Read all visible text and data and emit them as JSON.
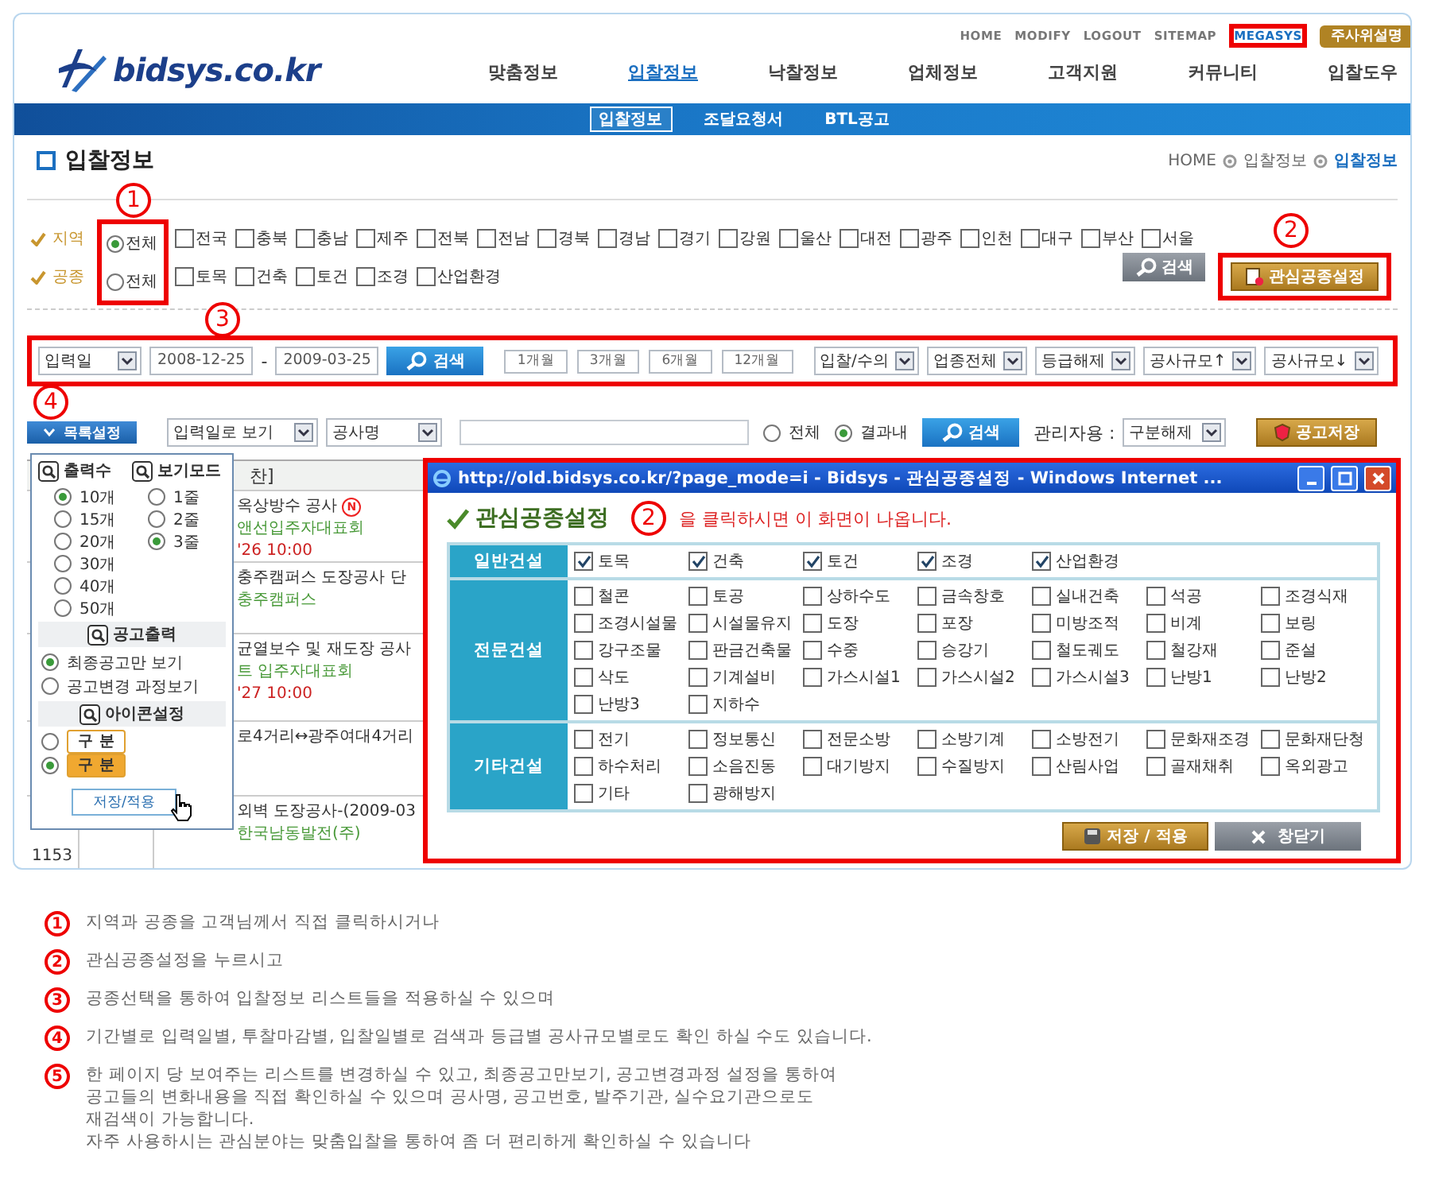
{
  "header": {
    "logo": "bidsys.co.kr",
    "top_links": [
      {
        "label": "HOME",
        "highlighted": false
      },
      {
        "label": "MODIFY",
        "highlighted": false
      },
      {
        "label": "LOGOUT",
        "highlighted": false
      },
      {
        "label": "SITEMAP",
        "highlighted": false
      },
      {
        "label": "MEGASYS",
        "highlighted": true
      }
    ],
    "top_button": "주사위설명",
    "nav": [
      {
        "label": "맞춤정보",
        "selected": false
      },
      {
        "label": "입찰정보",
        "selected": true
      },
      {
        "label": "낙찰정보",
        "selected": false
      },
      {
        "label": "업체정보",
        "selected": false
      },
      {
        "label": "고객지원",
        "selected": false
      },
      {
        "label": "커뮤니티",
        "selected": false
      },
      {
        "label": "입찰도우",
        "selected": false
      }
    ],
    "subnav": [
      {
        "label": "입찰정보",
        "selected": true
      },
      {
        "label": "조달요청서",
        "selected": false
      },
      {
        "label": "BTL공고",
        "selected": false
      }
    ]
  },
  "page_title": "입찰정보",
  "breadcrumb": [
    "HOME",
    "입찰정보",
    "입찰정보"
  ],
  "filters": [
    {
      "label": "지역",
      "options": [
        {
          "label": "전체",
          "kind": "radio",
          "checked": true
        },
        {
          "label": "전국",
          "kind": "checkbox",
          "checked": false
        },
        {
          "label": "충북",
          "kind": "checkbox",
          "checked": false
        },
        {
          "label": "충남",
          "kind": "checkbox",
          "checked": false
        },
        {
          "label": "제주",
          "kind": "checkbox",
          "checked": false
        },
        {
          "label": "전북",
          "kind": "checkbox",
          "checked": false
        },
        {
          "label": "전남",
          "kind": "checkbox",
          "checked": false
        },
        {
          "label": "경북",
          "kind": "checkbox",
          "checked": false
        },
        {
          "label": "경남",
          "kind": "checkbox",
          "checked": false
        },
        {
          "label": "경기",
          "kind": "checkbox",
          "checked": false
        },
        {
          "label": "강원",
          "kind": "checkbox",
          "checked": false
        },
        {
          "label": "울산",
          "kind": "checkbox",
          "checked": false
        },
        {
          "label": "대전",
          "kind": "checkbox",
          "checked": false
        },
        {
          "label": "광주",
          "kind": "checkbox",
          "checked": false
        },
        {
          "label": "인천",
          "kind": "checkbox",
          "checked": false
        },
        {
          "label": "대구",
          "kind": "checkbox",
          "checked": false
        },
        {
          "label": "부산",
          "kind": "checkbox",
          "checked": false
        },
        {
          "label": "서울",
          "kind": "checkbox",
          "checked": false
        }
      ]
    },
    {
      "label": "공종",
      "options": [
        {
          "label": "전체",
          "kind": "radio",
          "checked": false
        },
        {
          "label": "토목",
          "kind": "checkbox",
          "checked": false
        },
        {
          "label": "건축",
          "kind": "checkbox",
          "checked": false
        },
        {
          "label": "토건",
          "kind": "checkbox",
          "checked": false
        },
        {
          "label": "조경",
          "kind": "checkbox",
          "checked": false
        },
        {
          "label": "산업환경",
          "kind": "checkbox",
          "checked": false
        }
      ]
    }
  ],
  "filter_buttons": {
    "search": "검색",
    "interest": "관심공종설정"
  },
  "date_bar": {
    "date_type": "입력일",
    "from": "2008-12-25",
    "separator": "-",
    "to": "2009-03-25",
    "search": "검색",
    "periods": [
      "1개월",
      "3개월",
      "6개월",
      "12개월"
    ],
    "selects": [
      "입찰/수의",
      "업종전체",
      "등급해제",
      "공사규모↑",
      "공사규모↓"
    ]
  },
  "list_bar": {
    "settings_button": "목록설정",
    "view_select": "입력일로 보기",
    "field_select": "공사명",
    "scope": [
      {
        "label": "전체",
        "selected": false
      },
      {
        "label": "결과내",
        "selected": true
      }
    ],
    "search": "검색",
    "admin_label": "관리자용 :",
    "admin_select": "구분해제",
    "save": "공고저장"
  },
  "settings_panel": {
    "count_title": "출력수",
    "counts": [
      {
        "label": "10개",
        "selected": true
      },
      {
        "label": "15개",
        "selected": false
      },
      {
        "label": "20개",
        "selected": false
      },
      {
        "label": "30개",
        "selected": false
      },
      {
        "label": "40개",
        "selected": false
      },
      {
        "label": "50개",
        "selected": false
      }
    ],
    "mode_title": "보기모드",
    "modes": [
      {
        "label": "1줄",
        "selected": false
      },
      {
        "label": "2줄",
        "selected": false
      },
      {
        "label": "3줄",
        "selected": true
      }
    ],
    "notice_title": "공고출력",
    "notice_options": [
      {
        "label": "최종공고만 보기",
        "selected": true
      },
      {
        "label": "공고변경 과정보기",
        "selected": false
      }
    ],
    "icon_title": "아이콘설정",
    "icon_options": [
      {
        "label": "구 분",
        "kind": "outline",
        "selected": false
      },
      {
        "label": "구 분",
        "kind": "filled",
        "selected": true
      }
    ],
    "apply": "저장/적용"
  },
  "list": {
    "header": "찬]",
    "rows": [
      {
        "number": "",
        "lines": [
          {
            "kind": "title",
            "text": "옥상방수 공사",
            "badge": "N"
          },
          {
            "kind": "org",
            "text": "앤선입주자대표회"
          },
          {
            "kind": "date",
            "text": "'26 10:00"
          }
        ]
      },
      {
        "number": "",
        "lines": [
          {
            "kind": "title",
            "text": "충주캠퍼스 도장공사 단"
          },
          {
            "kind": "org",
            "text": "충주캠퍼스"
          }
        ]
      },
      {
        "number": "",
        "lines": [
          {
            "kind": "title",
            "text": "균열보수 및 재도장 공사"
          },
          {
            "kind": "org",
            "text": "트 입주자대표회"
          },
          {
            "kind": "date",
            "text": "'27 10:00"
          }
        ]
      },
      {
        "number": "",
        "lines": [
          {
            "kind": "title",
            "text": "로4거리↔광주여대4거리"
          }
        ]
      },
      {
        "number": "1153",
        "lines": [
          {
            "kind": "title",
            "text": "외벽 도장공사-(2009-03"
          },
          {
            "kind": "org",
            "text": "한국남동발전(주)"
          }
        ]
      }
    ]
  },
  "popup": {
    "title": "http://old.bidsys.co.kr/?page_mode=i - Bidsys - 관심공종설정 - Windows Internet ...",
    "heading": "관심공종설정",
    "heading_marker": "2",
    "heading_note": "을 클릭하시면 이 화면이 나옵니다.",
    "groups": [
      {
        "name": "일반건설",
        "items": [
          {
            "label": "토목",
            "checked": true
          },
          {
            "label": "건축",
            "checked": true
          },
          {
            "label": "토건",
            "checked": true
          },
          {
            "label": "조경",
            "checked": true
          },
          {
            "label": "산업환경",
            "checked": true
          }
        ]
      },
      {
        "name": "전문건설",
        "items": [
          {
            "label": "철콘",
            "checked": false
          },
          {
            "label": "토공",
            "checked": false
          },
          {
            "label": "상하수도",
            "checked": false
          },
          {
            "label": "금속창호",
            "checked": false
          },
          {
            "label": "실내건축",
            "checked": false
          },
          {
            "label": "석공",
            "checked": false
          },
          {
            "label": "조경식재",
            "checked": false
          },
          {
            "label": "조경시설물",
            "checked": false
          },
          {
            "label": "시설물유지",
            "checked": false
          },
          {
            "label": "도장",
            "checked": false
          },
          {
            "label": "포장",
            "checked": false
          },
          {
            "label": "미방조적",
            "checked": false
          },
          {
            "label": "비계",
            "checked": false
          },
          {
            "label": "보링",
            "checked": false
          },
          {
            "label": "강구조물",
            "checked": false
          },
          {
            "label": "판금건축물",
            "checked": false
          },
          {
            "label": "수중",
            "checked": false
          },
          {
            "label": "승강기",
            "checked": false
          },
          {
            "label": "철도궤도",
            "checked": false
          },
          {
            "label": "철강재",
            "checked": false
          },
          {
            "label": "준설",
            "checked": false
          },
          {
            "label": "삭도",
            "checked": false
          },
          {
            "label": "기계설비",
            "checked": false
          },
          {
            "label": "가스시설1",
            "checked": false
          },
          {
            "label": "가스시설2",
            "checked": false
          },
          {
            "label": "가스시설3",
            "checked": false
          },
          {
            "label": "난방1",
            "checked": false
          },
          {
            "label": "난방2",
            "checked": false
          },
          {
            "label": "난방3",
            "checked": false
          },
          {
            "label": "지하수",
            "checked": false
          }
        ]
      },
      {
        "name": "기타건설",
        "items": [
          {
            "label": "전기",
            "checked": false
          },
          {
            "label": "정보통신",
            "checked": false
          },
          {
            "label": "전문소방",
            "checked": false
          },
          {
            "label": "소방기계",
            "checked": false
          },
          {
            "label": "소방전기",
            "checked": false
          },
          {
            "label": "문화재조경",
            "checked": false
          },
          {
            "label": "문화재단청",
            "checked": false
          },
          {
            "label": "하수처리",
            "checked": false
          },
          {
            "label": "소음진동",
            "checked": false
          },
          {
            "label": "대기방지",
            "checked": false
          },
          {
            "label": "수질방지",
            "checked": false
          },
          {
            "label": "산림사업",
            "checked": false
          },
          {
            "label": "골재채취",
            "checked": false
          },
          {
            "label": "옥외광고",
            "checked": false
          },
          {
            "label": "기타",
            "checked": false
          },
          {
            "label": "광해방지",
            "checked": false
          }
        ]
      }
    ],
    "buttons": [
      "저장 / 적용",
      "창닫기"
    ]
  },
  "annotations": [
    "1",
    "2",
    "3",
    "4"
  ],
  "notes": [
    {
      "number": "1",
      "lines": [
        "지역과 공종을 고객님께서 직접 클릭하시거나"
      ]
    },
    {
      "number": "2",
      "lines": [
        "관심공종설정을 누르시고"
      ]
    },
    {
      "number": "3",
      "lines": [
        "공종선택을 통하여 입찰정보 리스트들을 적용하실 수 있으며"
      ]
    },
    {
      "number": "4",
      "lines": [
        "기간별로 입력일별, 투찰마감별, 입찰일별로 검색과 등급별 공사규모별로도 확인 하실 수도 있습니다."
      ]
    },
    {
      "number": "5",
      "lines": [
        "한 페이지 당 보여주는 리스트를 변경하실 수 있고, 최종공고만보기, 공고변경과정 설정을 통하여",
        "공고들의 변화내용을 직접 확인하실 수 있으며 공사명, 공고번호, 발주기관, 실수요기관으로도",
        "재검색이 가능합니다.",
        "자주 사용하시는 관심분야는 맞춤입찰을 통하여 좀 더 편리하게 확인하실 수 있습니다"
      ]
    }
  ]
}
